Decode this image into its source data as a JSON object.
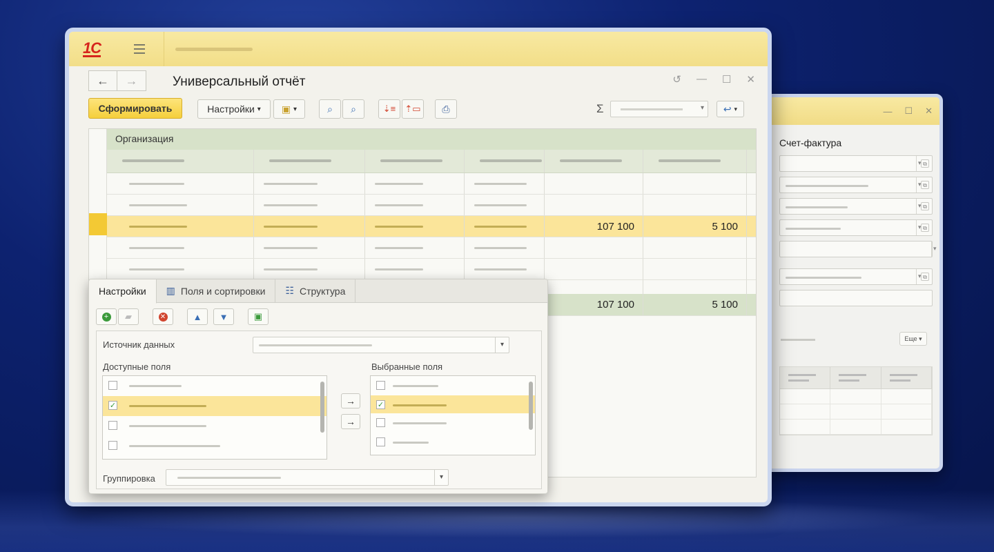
{
  "main": {
    "title": "Универсальный отчёт",
    "toolbar": {
      "generate_label": "Сформировать",
      "settings_label": "Настройки"
    },
    "report": {
      "group_label": "Организация",
      "highlight_values": [
        "107 100",
        "5 100"
      ],
      "total_values": [
        "107 100",
        "5 100"
      ]
    }
  },
  "panel": {
    "tabs": [
      "Настройки",
      "Поля и сортировки",
      "Структура"
    ],
    "data_source_label": "Источник данных",
    "available_fields_label": "Доступные поля",
    "selected_fields_label": "Выбранные поля",
    "grouping_label": "Группировка"
  },
  "back": {
    "title": "Счет-фактура",
    "more_label": "Еще"
  },
  "colors": {
    "accent_yellow": "#f5cf3c",
    "highlight_row": "#fbe59a",
    "group_green": "#d7e2c9",
    "logo_red": "#d6241c"
  }
}
